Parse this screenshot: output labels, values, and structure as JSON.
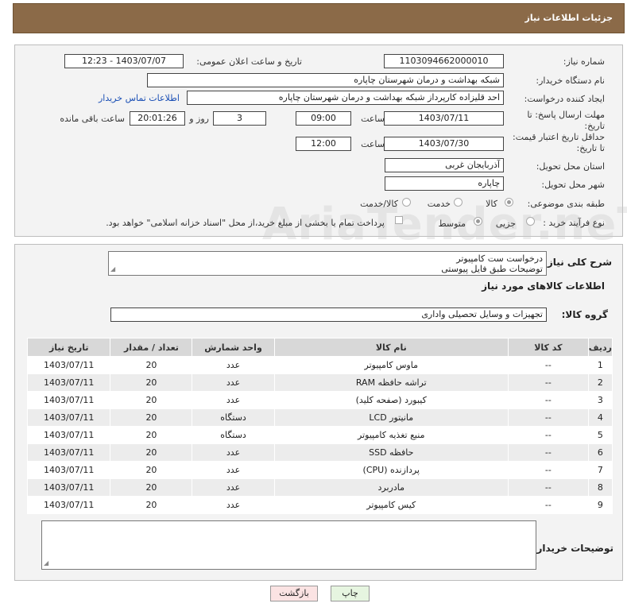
{
  "header": {
    "title": "جزئیات اطلاعات نیاز"
  },
  "form": {
    "need_number_label": "شماره نیاز:",
    "need_number": "1103094662000010",
    "announce_label": "تاریخ و ساعت اعلان عمومی:",
    "announce_value": "1403/07/07 - 12:23",
    "buyer_org_label": "نام دستگاه خریدار:",
    "buyer_org": "شبکه بهداشت و درمان شهرستان چاپاره",
    "creator_label": "ایجاد کننده درخواست:",
    "creator": "احد قلیزاده کارپرداز شبکه بهداشت و درمان شهرستان چاپاره",
    "contact_link": "اطلاعات تماس خریدار",
    "reply_deadline_label": "مهلت ارسال پاسخ: تا تاریخ:",
    "reply_date": "1403/07/11",
    "time_label": "ساعت",
    "reply_time": "09:00",
    "days_value": "3",
    "days_label": "روز و",
    "remaining_time": "20:01:26",
    "remaining_label": "ساعت باقی مانده",
    "price_validity_label": "حداقل تاریخ اعتبار قیمت: تا تاریخ:",
    "price_date": "1403/07/30",
    "price_time": "12:00",
    "province_label": "استان محل تحویل:",
    "province": "آذربایجان غربی",
    "city_label": "شهر محل تحویل:",
    "city": "چاپاره",
    "category_label": "طبقه بندی موضوعی:",
    "category_options": [
      "کالا",
      "خدمت",
      "کالا/خدمت"
    ],
    "process_label": "نوع فرآیند خرید :",
    "process_options": [
      "جزیی",
      "متوسط"
    ],
    "payment_note": "پرداخت تمام یا بخشی از مبلغ خرید،از محل \"اسناد خزانه اسلامی\" خواهد بود."
  },
  "description": {
    "label": "شرح کلی نیاز:",
    "lines": [
      "درخواست ست کامپیوتر",
      "توضیحات طبق فایل پیوستی"
    ]
  },
  "goods": {
    "section_title": "اطلاعات کالاهای مورد نیاز",
    "group_label": "گروه کالا:",
    "group_value": "تجهیزات و وسایل تحصیلی واداری",
    "columns": [
      "ردیف",
      "کد کالا",
      "نام کالا",
      "واحد شمارش",
      "تعداد / مقدار",
      "تاریخ نیاز"
    ],
    "rows": [
      [
        "1",
        "--",
        "ماوس کامپیوتر",
        "عدد",
        "20",
        "1403/07/11"
      ],
      [
        "2",
        "--",
        "تراشه حافظه RAM",
        "عدد",
        "20",
        "1403/07/11"
      ],
      [
        "3",
        "--",
        "کیبورد (صفحه کلید)",
        "عدد",
        "20",
        "1403/07/11"
      ],
      [
        "4",
        "--",
        "مانیتور LCD",
        "دستگاه",
        "20",
        "1403/07/11"
      ],
      [
        "5",
        "--",
        "منبع تغذیه کامپیوتر",
        "دستگاه",
        "20",
        "1403/07/11"
      ],
      [
        "6",
        "--",
        "حافظه SSD",
        "عدد",
        "20",
        "1403/07/11"
      ],
      [
        "7",
        "--",
        "پردازنده (CPU)",
        "عدد",
        "20",
        "1403/07/11"
      ],
      [
        "8",
        "--",
        "مادربرد",
        "عدد",
        "20",
        "1403/07/11"
      ],
      [
        "9",
        "--",
        "کیس کامپیوتر",
        "عدد",
        "20",
        "1403/07/11"
      ]
    ]
  },
  "buyer_notes": {
    "label": "توضیحات خریدار:"
  },
  "buttons": {
    "print": "چاپ",
    "back": "بازگشت"
  },
  "watermark": "AriaTender.neT",
  "colors": {
    "header_bg": "#8b6a48",
    "print_bg": "#e6f5e0",
    "back_bg": "#fbe3e3"
  }
}
